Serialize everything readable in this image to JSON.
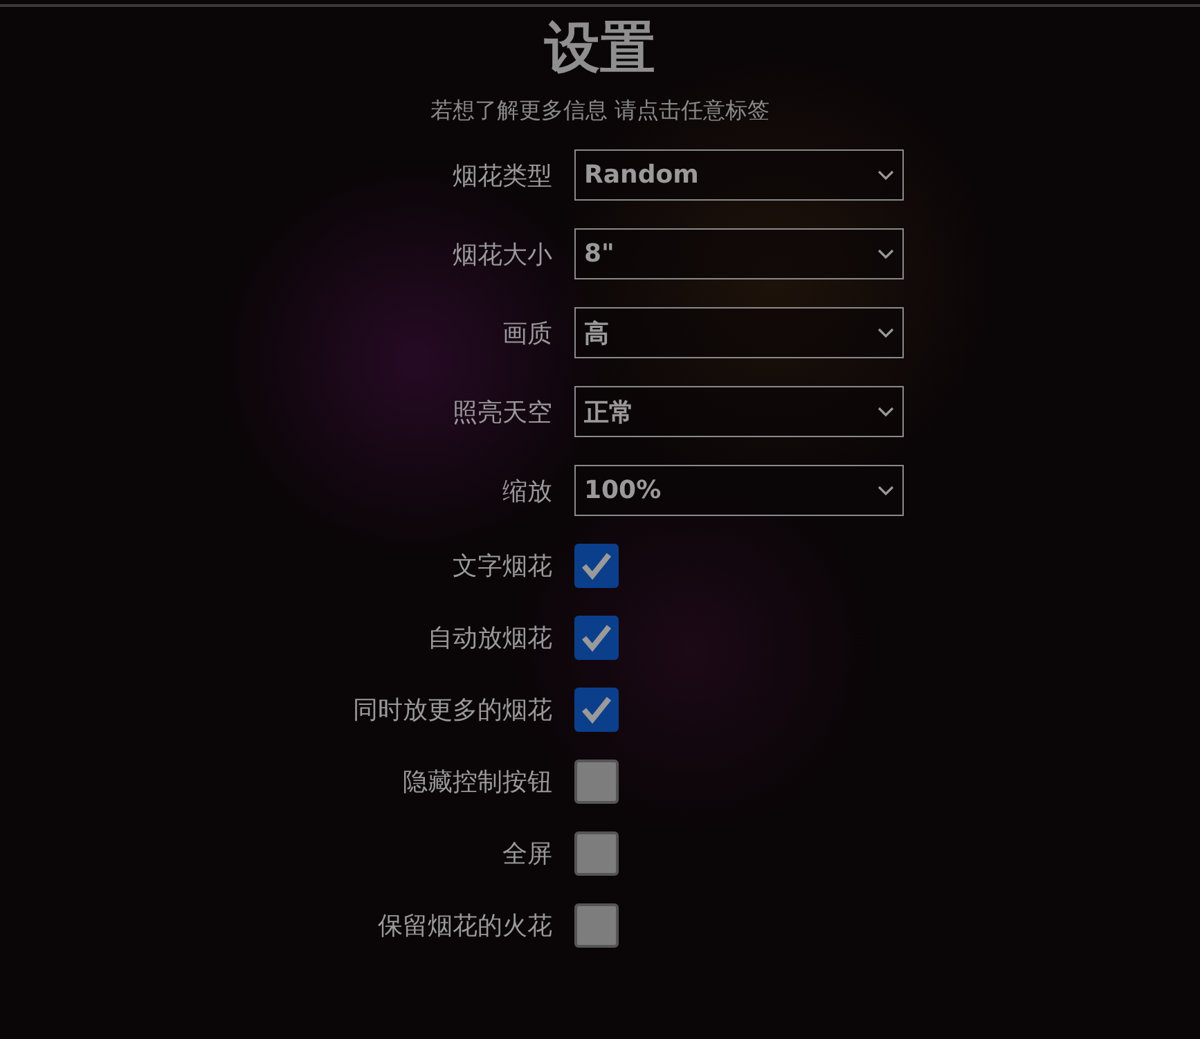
{
  "title": "设置",
  "subtitle": "若想了解更多信息 请点击任意标签",
  "settings": [
    {
      "kind": "select",
      "label": "烟花类型",
      "value": "Random"
    },
    {
      "kind": "select",
      "label": "烟花大小",
      "value": "8\""
    },
    {
      "kind": "select",
      "label": "画质",
      "value": "高"
    },
    {
      "kind": "select",
      "label": "照亮天空",
      "value": "正常"
    },
    {
      "kind": "select",
      "label": "缩放",
      "value": "100%"
    },
    {
      "kind": "checkbox",
      "label": "文字烟花",
      "checked": true
    },
    {
      "kind": "checkbox",
      "label": "自动放烟花",
      "checked": true
    },
    {
      "kind": "checkbox",
      "label": "同时放更多的烟花",
      "checked": true
    },
    {
      "kind": "checkbox",
      "label": "隐藏控制按钮",
      "checked": false
    },
    {
      "kind": "checkbox",
      "label": "全屏",
      "checked": false
    },
    {
      "kind": "checkbox",
      "label": "保留烟花的火花",
      "checked": false
    }
  ]
}
